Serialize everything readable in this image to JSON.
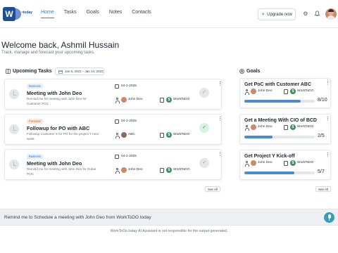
{
  "brand": {
    "logo_letters": "W",
    "logo_suffix": "•today"
  },
  "nav": {
    "items": [
      "Home",
      "Tasks",
      "Goals",
      "Notes",
      "Contacts"
    ],
    "active": "Home"
  },
  "header": {
    "upgrade_label": "Upgrade now"
  },
  "welcome": {
    "title": "Welcome back, Ashmil Hussain",
    "subtitle": "Track, manage and forecast your upcoming tasks."
  },
  "tasks": {
    "section_title": "Upcoming Tasks",
    "date_range": "Jan 6, 2022 – Jan 13, 2022",
    "see_all": "See All",
    "items": [
      {
        "tag": "Business",
        "title": "Meeting with  John Deo",
        "description": "Remind me for meeting with John Deo for Customer POC",
        "date": "04-1-2025",
        "assignee": "John Deo",
        "org": "WorkToDO",
        "done": false
      },
      {
        "tag": "Personal",
        "title": "Followup for PO with  ABC",
        "description": "Followup Customer X for PO for the project Y next week",
        "date": "04-1-2025",
        "assignee": "ABC",
        "org": "WorkToDO",
        "done": true
      },
      {
        "tag": "Business",
        "title": "Meeting with  John Deo",
        "description": "Remind me for meeting with John Deo for Dubai POC",
        "date": "04-1-2025",
        "assignee": "John Deo",
        "org": "WorkToDO",
        "done": false
      }
    ]
  },
  "goals": {
    "section_title": "Goals",
    "see_all": "See All",
    "items": [
      {
        "title": "Get PoC with Customer ABC",
        "assignee": "John Deo",
        "org": "WorkToDO",
        "count": "8/10",
        "progress": 0.8
      },
      {
        "title": "Get a Meeting With CIO of BCD",
        "assignee": "John Deo",
        "org": "WorkToDO",
        "count": "2/5",
        "progress": 0.4
      },
      {
        "title": "Get Project Y Kick-off",
        "assignee": "John Deo",
        "org": "WorkToDO",
        "count": "5/7",
        "progress": 0.71
      }
    ]
  },
  "assistant": {
    "prompt_value": "Remind me to Schedule a meeting with John Deo from WorkToDO today",
    "disclaimer": "WorkToDo.today AI Assistant is not responsible for the output generated."
  },
  "colors": {
    "accent": "#2f7fd0",
    "progress": "#4a8ad4",
    "mic": "#3b9bb8",
    "org_badge": "#3f8f5f"
  }
}
